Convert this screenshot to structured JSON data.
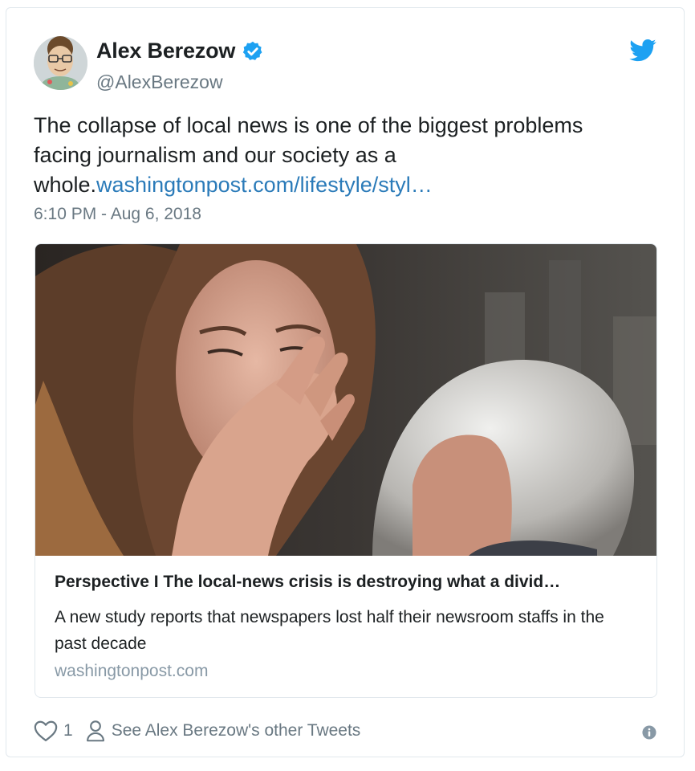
{
  "tweet": {
    "author_name": "Alex Berezow",
    "author_handle": "@AlexBerezow",
    "text_before_link": "The collapse of local news is one of the biggest problems facing journalism and our society as a whole.",
    "link_text": "washingtonpost.com/lifestyle/styl…",
    "timestamp": "6:10 PM - Aug 6, 2018",
    "like_count": "1",
    "other_tweets_label": "See Alex Berezow's other Tweets"
  },
  "link_card": {
    "title": "Perspective I The local-news crisis is destroying what a divid…",
    "description": "A new study reports that newspapers lost half their newsroom staffs in the past decade",
    "domain": "washingtonpost.com"
  },
  "icons": {
    "verified": "verified-badge-icon",
    "brand": "twitter-bird-icon",
    "like": "heart-icon",
    "profile": "person-icon",
    "info": "info-icon"
  },
  "colors": {
    "brand_blue": "#1da1f2",
    "link_blue": "#2b7bb9",
    "text": "#1c2022",
    "secondary_text": "#697882",
    "domain_text": "#8899a6",
    "border": "#e1e8ed"
  }
}
